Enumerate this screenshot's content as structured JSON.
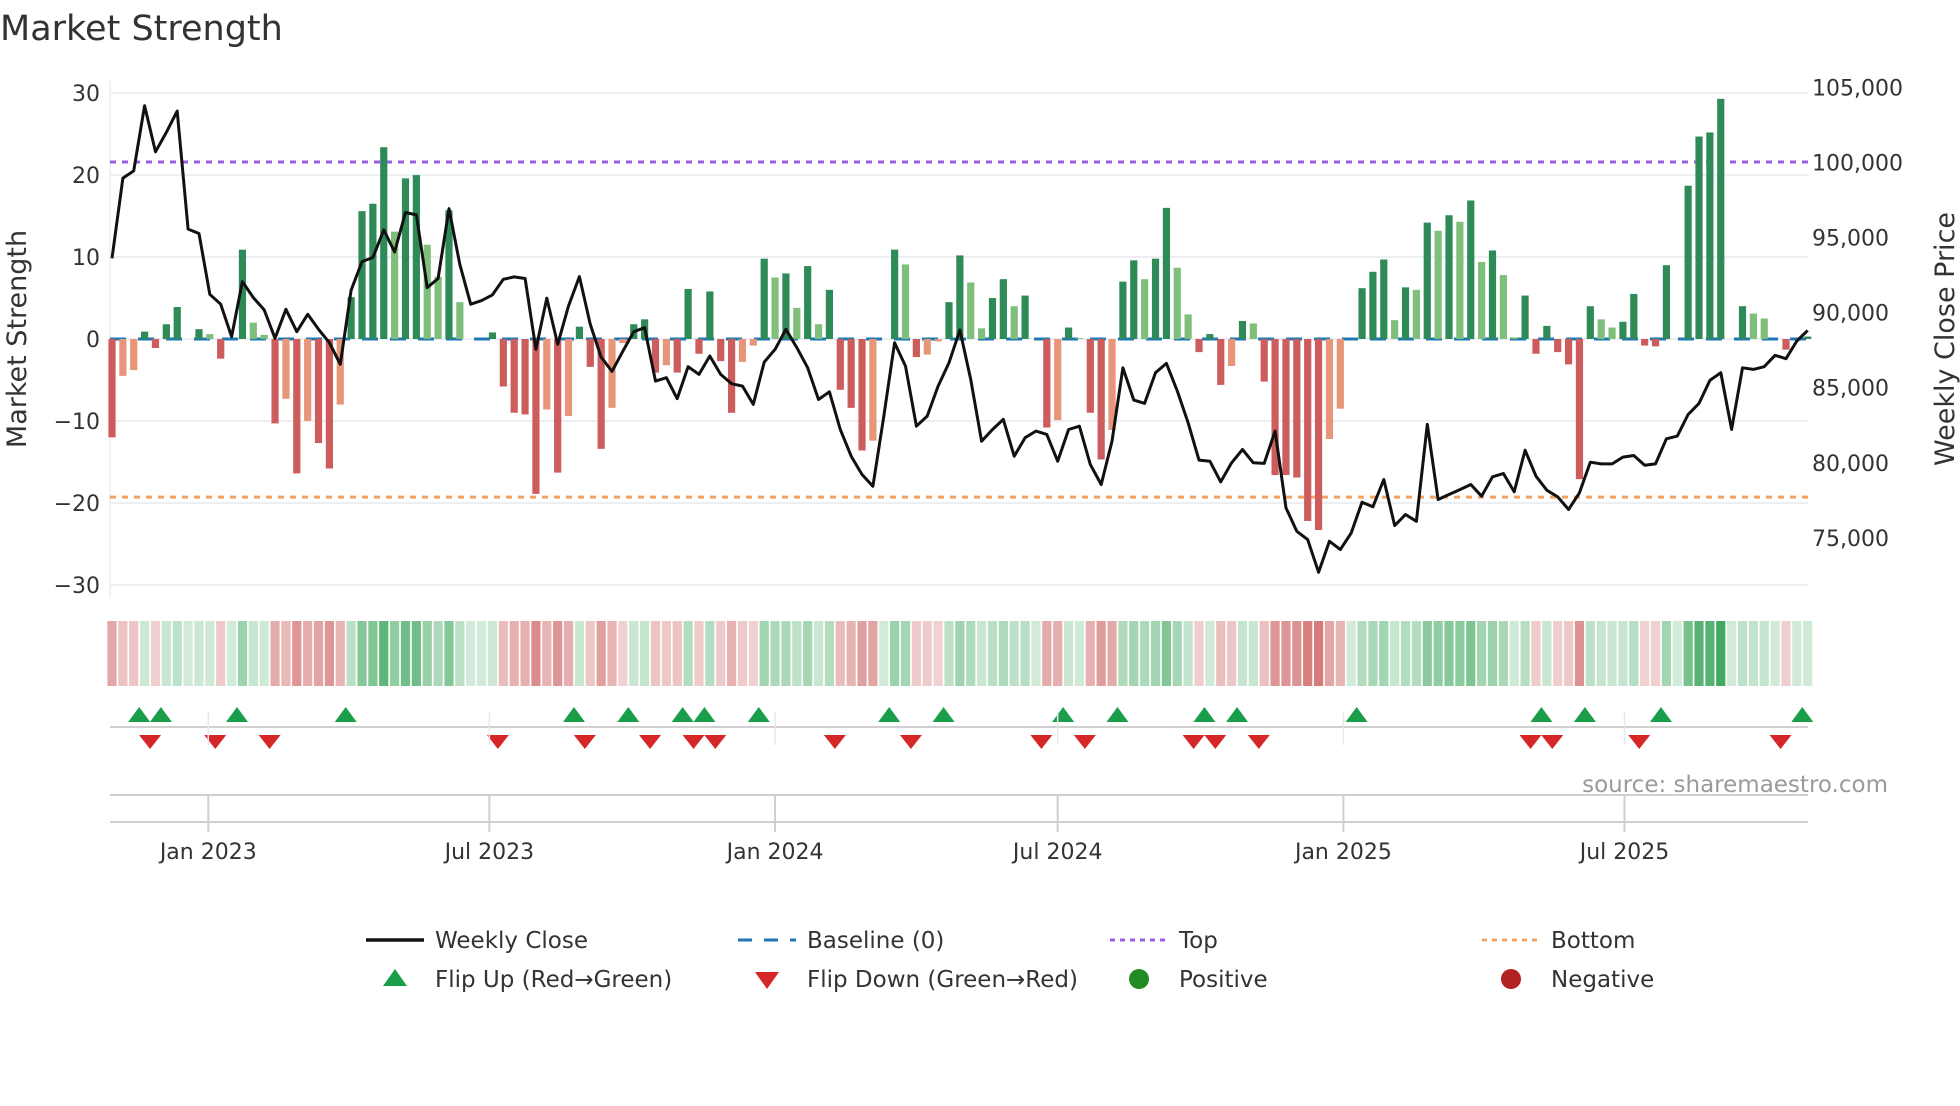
{
  "title": "Market Strength",
  "source": "source: sharemaestro.com",
  "colors": {
    "pos_strong": "#2e8b57",
    "pos_weak": "#7fbf7b",
    "neg_strong": "#cd5c5c",
    "neg_weak": "#e8967a",
    "baseline": "#1f77b4",
    "top": "#9b5de5",
    "bottom": "#f4a460",
    "close": "#111111",
    "flip_up": "#1a9e4a",
    "flip_down": "#d62728",
    "positive": "#228b22",
    "negative": "#b22222"
  },
  "chart_data": {
    "type": "bar+line",
    "title": "Market Strength",
    "ylabel": "Market Strength",
    "y2label": "Weekly Close Price",
    "ylim": [
      -31.6,
      31.6
    ],
    "y2lim": [
      71000,
      105490
    ],
    "yticks": [
      30,
      20,
      10,
      0,
      -10,
      -20,
      -30
    ],
    "ytick_labels": [
      "30",
      "20",
      "10",
      "0",
      "−10",
      "−20",
      "−30"
    ],
    "y2ticks": [
      105000,
      100000,
      95000,
      90000,
      85000,
      80000,
      75000
    ],
    "y2tick_labels": [
      "105,000",
      "100,000",
      "95,000",
      "90,000",
      "85,000",
      "80,000",
      "75,000"
    ],
    "x_start": "2022-10-31",
    "x_step_days": 7,
    "xticks": [
      {
        "date": "2023-01-01",
        "label": "Jan 2023"
      },
      {
        "date": "2023-07-01",
        "label": "Jul 2023"
      },
      {
        "date": "2024-01-01",
        "label": "Jan 2024"
      },
      {
        "date": "2024-07-01",
        "label": "Jul 2024"
      },
      {
        "date": "2025-01-01",
        "label": "Jan 2025"
      },
      {
        "date": "2025-07-01",
        "label": "Jul 2025"
      }
    ],
    "top_level": 21.6,
    "bottom_level": -19.3,
    "baseline": 0,
    "strength": [
      -12.0,
      -4.5,
      -3.8,
      0.9,
      -1.1,
      1.8,
      3.9,
      0,
      1.2,
      0.6,
      -2.4,
      0,
      10.9,
      2.0,
      0.5,
      -10.3,
      -7.3,
      -16.4,
      -10.0,
      -12.7,
      -15.8,
      -8.0,
      5.1,
      15.6,
      16.5,
      23.4,
      13.1,
      19.6,
      20.0,
      11.5,
      7.6,
      15.7,
      4.5,
      0,
      0,
      0.8,
      -5.8,
      -9.0,
      -9.2,
      -18.9,
      -8.6,
      -16.3,
      -9.4,
      1.5,
      -3.4,
      -13.4,
      -8.4,
      -0.5,
      1.8,
      2.4,
      -4.1,
      -3.2,
      -4.1,
      6.1,
      -1.8,
      5.8,
      -2.7,
      -9.0,
      -2.8,
      -0.8,
      9.8,
      7.5,
      8.0,
      3.8,
      8.9,
      1.8,
      6.0,
      -6.2,
      -8.4,
      -13.6,
      -12.4,
      0,
      10.9,
      9.1,
      -2.2,
      -1.9,
      -0.3,
      4.5,
      10.2,
      6.9,
      1.3,
      5.0,
      7.3,
      4.0,
      5.3,
      0,
      -10.8,
      -9.9,
      1.4,
      0.1,
      -9.0,
      -14.7,
      -11.1,
      7.0,
      9.6,
      7.3,
      9.8,
      16.0,
      8.7,
      3.0,
      -1.6,
      0.6,
      -5.6,
      -3.3,
      2.2,
      1.9,
      -5.2,
      -16.6,
      -16.6,
      -16.9,
      -22.2,
      -23.3,
      -12.2,
      -8.5,
      0,
      6.2,
      8.2,
      9.7,
      2.3,
      6.3,
      6.0,
      14.2,
      13.2,
      15.1,
      14.3,
      16.9,
      9.4,
      10.8,
      7.8,
      0.2,
      5.3,
      -1.8,
      1.6,
      -1.6,
      -3.1,
      -17.1,
      4.0,
      2.4,
      1.4,
      2.1,
      5.5,
      -0.8,
      -0.9,
      9.0,
      0,
      18.7,
      24.7,
      25.2,
      29.3,
      0,
      4.0,
      3.1,
      2.5,
      0,
      -1.3,
      0,
      0.3
    ],
    "weekly_close": [
      93620,
      98960,
      99440,
      103780,
      100710,
      102000,
      103420,
      95560,
      95270,
      91220,
      90560,
      88400,
      92070,
      91000,
      90180,
      88290,
      90220,
      88730,
      89890,
      88890,
      88000,
      86560,
      91490,
      93400,
      93670,
      95510,
      94040,
      96670,
      96510,
      91670,
      92270,
      96930,
      93220,
      90560,
      90800,
      91180,
      92220,
      92380,
      92270,
      87560,
      90960,
      87890,
      90440,
      92400,
      89220,
      87040,
      86090,
      87440,
      88730,
      89000,
      85440,
      85670,
      84270,
      86400,
      85890,
      87110,
      85890,
      85270,
      85110,
      83890,
      86710,
      87560,
      88890,
      87670,
      86330,
      84220,
      84730,
      82220,
      80440,
      79220,
      78440,
      83100,
      88000,
      86440,
      82440,
      83110,
      85110,
      86670,
      88840,
      85560,
      81440,
      82220,
      82890,
      80440,
      81670,
      82110,
      81890,
      80110,
      82220,
      82440,
      79890,
      78560,
      81440,
      86330,
      84180,
      83960,
      86000,
      86620,
      84780,
      82670,
      80180,
      80110,
      78730,
      80000,
      80890,
      80000,
      79960,
      82110,
      77000,
      75440,
      74890,
      72710,
      74780,
      74220,
      75330,
      77380,
      77070,
      78890,
      75820,
      76560,
      76110,
      82560,
      77560,
      77890,
      78220,
      78560,
      77780,
      79070,
      79290,
      78070,
      80840,
      79110,
      78180,
      77730,
      76890,
      78000,
      80040,
      79930,
      79930,
      80380,
      80490,
      79840,
      79930,
      81600,
      81780,
      83220,
      83960,
      85490,
      86000,
      82220,
      86330,
      86220,
      86400,
      87160,
      86930,
      88110,
      88820
    ],
    "legend": [
      {
        "key": "close",
        "label": "Weekly Close",
        "symbol": "solid-line"
      },
      {
        "key": "baseline",
        "label": "Baseline (0)",
        "symbol": "dashed-line"
      },
      {
        "key": "top",
        "label": "Top",
        "symbol": "dotted-line"
      },
      {
        "key": "bottom",
        "label": "Bottom",
        "symbol": "dotted-line"
      },
      {
        "key": "flip_up",
        "label": "Flip Up (Red→Green)",
        "symbol": "triangle-up"
      },
      {
        "key": "flip_down",
        "label": "Flip Down (Green→Red)",
        "symbol": "triangle-down"
      },
      {
        "key": "positive",
        "label": "Positive",
        "symbol": "circle"
      },
      {
        "key": "negative",
        "label": "Negative",
        "symbol": "circle"
      }
    ],
    "legend_position": "bottom-center",
    "grid": true
  }
}
